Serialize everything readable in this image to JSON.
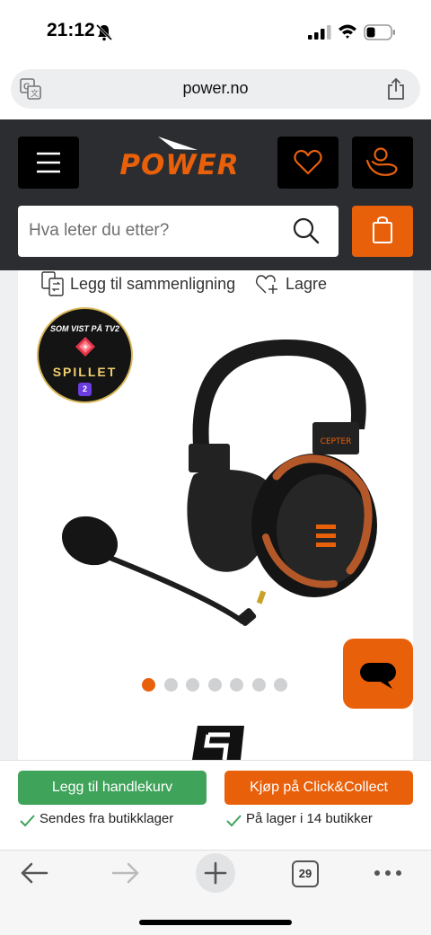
{
  "status_bar": {
    "time": "21:12"
  },
  "url_bar": {
    "url": "power.no"
  },
  "header": {
    "logo_text": "POWER",
    "search_placeholder": "Hva leter du etter?"
  },
  "product": {
    "compare_label": "Legg til sammenligning",
    "save_label": "Lagre",
    "badge": {
      "top_text": "SOM VIST PÅ TV2",
      "main_text": "SPILLET",
      "logo_text": "2"
    },
    "headset_brand_text": "CEPTER",
    "gallery": {
      "count": 7,
      "active_index": 0
    }
  },
  "buy_bar": {
    "add_to_cart_label": "Legg til handlekurv",
    "click_collect_label": "Kjøp på Click&Collect",
    "ship_status": "Sendes fra butikklager",
    "stock_status": "På lager i 14 butikker"
  },
  "browser_toolbar": {
    "tab_count": "29"
  },
  "colors": {
    "brand_orange": "#e9600b",
    "header_dark": "#2b2d30",
    "cart_green": "#3fa35a"
  },
  "icons": [
    "bell-slash-icon",
    "signal-icon",
    "wifi-icon",
    "battery-icon",
    "translate-icon",
    "share-icon",
    "menu-icon",
    "heart-icon",
    "account-icon",
    "search-icon",
    "shopping-bag-icon",
    "compare-icon",
    "heart-plus-icon",
    "chat-icon",
    "check-icon",
    "back-icon",
    "forward-icon",
    "plus-icon",
    "more-icon"
  ]
}
